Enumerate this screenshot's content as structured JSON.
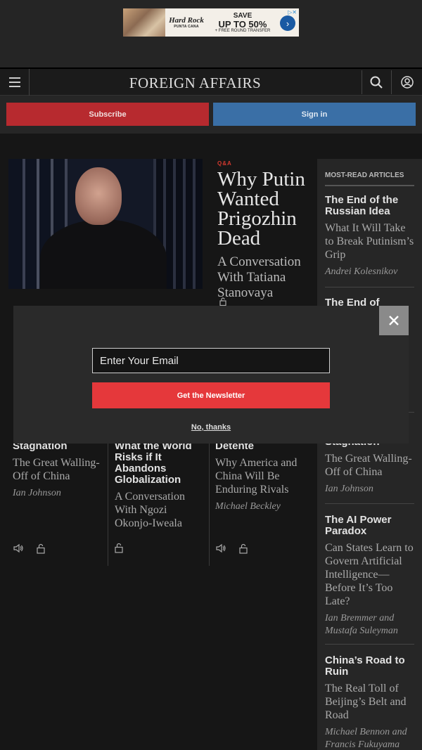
{
  "ad": {
    "brand_line1": "Hard Rock",
    "brand_line2": "PUNTA CANA",
    "offer_line1": "SAVE",
    "offer_line2": "UP TO 50%",
    "offer_line3": "+ FREE ROUND TRANSFER",
    "arrow_icon": "chevron-right-icon",
    "adchoices_icon": "adchoices-icon"
  },
  "header": {
    "logo": "FOREIGN AFFAIRS",
    "menu_icon": "hamburger-menu-icon",
    "search_icon": "search-icon",
    "account_icon": "user-account-icon"
  },
  "auth": {
    "subscribe_label": "Subscribe",
    "signin_label": "Sign in",
    "subscribe_color": "#b72a2f",
    "signin_color": "#3a6fa6"
  },
  "hero": {
    "kicker": "Q&A",
    "title": "Why Putin Wanted Prigozhin Dead",
    "dek": "A Conversation With Tatiana Stanovaya"
  },
  "sidebar": {
    "heading": "MOST-READ ARTICLES",
    "articles": [
      {
        "title": "The End of the Russian Idea",
        "dek": "What It Will Take to Break Putinism’s Grip",
        "author": "Andrei Kolesnikov"
      },
      {
        "title": "The End of",
        "dek": "",
        "author": ""
      },
      {
        "title": "Stagnation",
        "dek": "The Great Walling-Off of China",
        "author": "Ian Johnson"
      },
      {
        "title": "The AI Power Paradox",
        "dek": "Can States Learn to Govern Artificial Intelligence—Before It’s Too Late?",
        "author": "Ian Bremmer and Mustafa Suleyman"
      },
      {
        "title": "China’s Road to Ruin",
        "dek": "The Real Toll of Beijing’s Belt and Road",
        "author": "Michael Bennon and Francis Fukuyama"
      }
    ]
  },
  "row": {
    "col1": {
      "title": "Stagnation",
      "dek": "The Great Walling-Off of China",
      "author": "Ian Johnson"
    },
    "col2": {
      "title": "What the World Risks if It Abandons Globalization",
      "dek": "A Conversation With Ngozi Okonjo-Iweala"
    },
    "col3": {
      "title": "Detente",
      "dek": "Why America and China Will Be Enduring Rivals",
      "author": "Michael Beckley"
    }
  },
  "modal": {
    "email_placeholder": "Enter Your Email",
    "button_label": "Get the Newsletter",
    "dismiss_label": "No, thanks",
    "button_color": "#e5383b"
  }
}
